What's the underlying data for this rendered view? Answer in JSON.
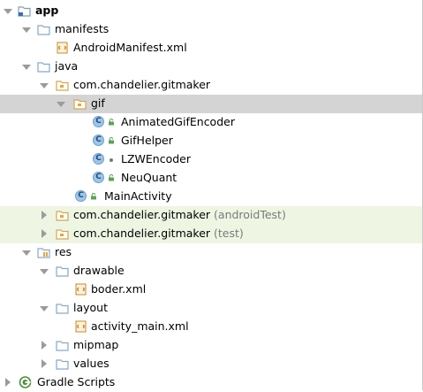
{
  "tree": {
    "app": "app",
    "manifests": "manifests",
    "android_manifest": "AndroidManifest.xml",
    "java": "java",
    "pkg_main": "com.chandelier.gitmaker",
    "gif": "gif",
    "animated_gif_encoder": "AnimatedGifEncoder",
    "gif_helper": "GifHelper",
    "lzw_encoder": "LZWEncoder",
    "neu_quant": "NeuQuant",
    "main_activity": "MainActivity",
    "pkg_android_test": "com.chandelier.gitmaker",
    "pkg_android_test_suffix": "(androidTest)",
    "pkg_test": "com.chandelier.gitmaker",
    "pkg_test_suffix": "(test)",
    "res": "res",
    "drawable": "drawable",
    "boder_xml": "boder.xml",
    "layout": "layout",
    "activity_main_xml": "activity_main.xml",
    "mipmap": "mipmap",
    "values": "values",
    "gradle_scripts": "Gradle Scripts"
  },
  "colors": {
    "selection": "#d4d4d4",
    "test_highlight": "#eef6e3",
    "folder": "#87a9c9",
    "package_folder": "#e3a63a",
    "class_icon": "#9fc5e8",
    "lock_green": "#5aa454"
  }
}
